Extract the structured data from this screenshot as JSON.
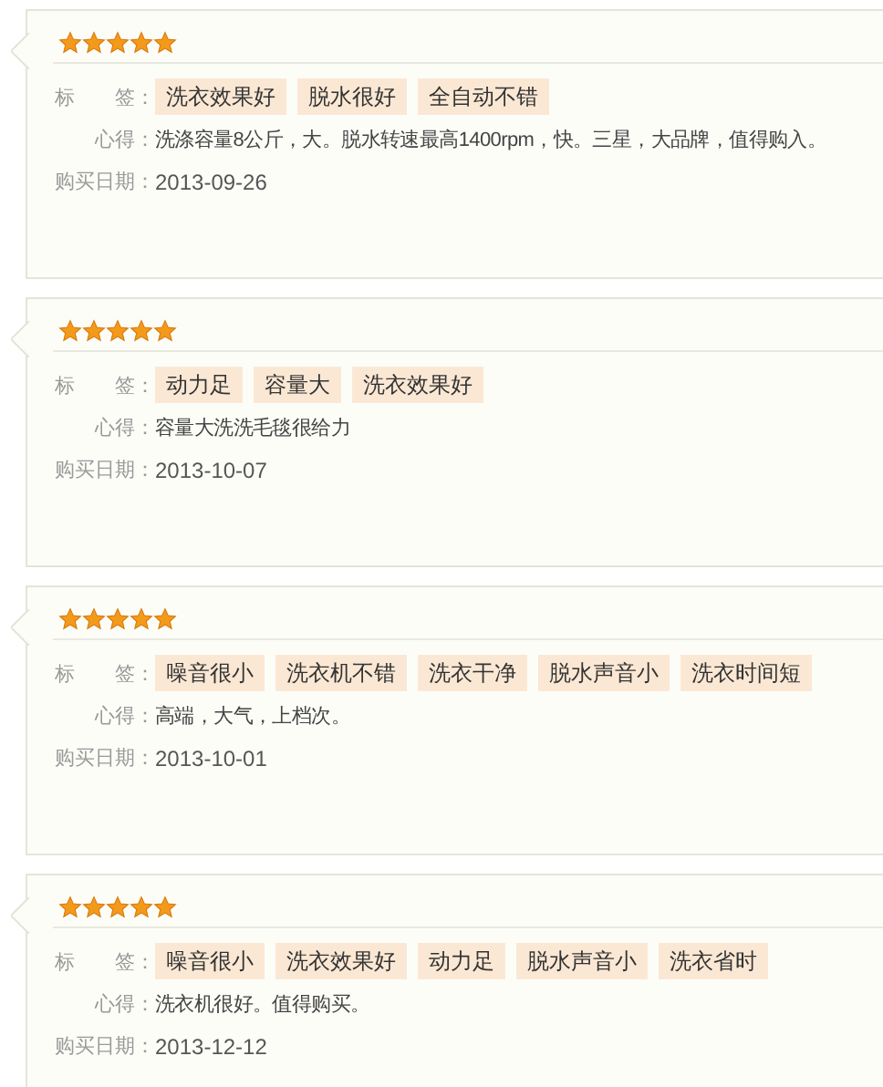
{
  "reviews": [
    {
      "stars": 5,
      "tags_label": "标　　签：",
      "tags": [
        "洗衣效果好",
        "脱水很好",
        "全自动不错"
      ],
      "comment_label": "心得：",
      "comment": "洗涤容量8公斤，大。脱水转速最高1400rpm，快。三星，大品牌，值得购入。",
      "date_label": "购买日期：",
      "date": "2013-09-26"
    },
    {
      "stars": 5,
      "tags_label": "标　　签：",
      "tags": [
        "动力足",
        "容量大",
        "洗衣效果好"
      ],
      "comment_label": "心得：",
      "comment": "容量大洗洗毛毯很给力",
      "date_label": "购买日期：",
      "date": "2013-10-07"
    },
    {
      "stars": 5,
      "tags_label": "标　　签：",
      "tags": [
        "噪音很小",
        "洗衣机不错",
        "洗衣干净",
        "脱水声音小",
        "洗衣时间短"
      ],
      "comment_label": "心得：",
      "comment": "高端，大气，上档次。",
      "date_label": "购买日期：",
      "date": "2013-10-01"
    },
    {
      "stars": 5,
      "tags_label": "标　　签：",
      "tags": [
        "噪音很小",
        "洗衣效果好",
        "动力足",
        "脱水声音小",
        "洗衣省时"
      ],
      "comment_label": "心得：",
      "comment": "洗衣机很好。值得购买。",
      "date_label": "购买日期：",
      "date": "2013-12-12"
    }
  ]
}
